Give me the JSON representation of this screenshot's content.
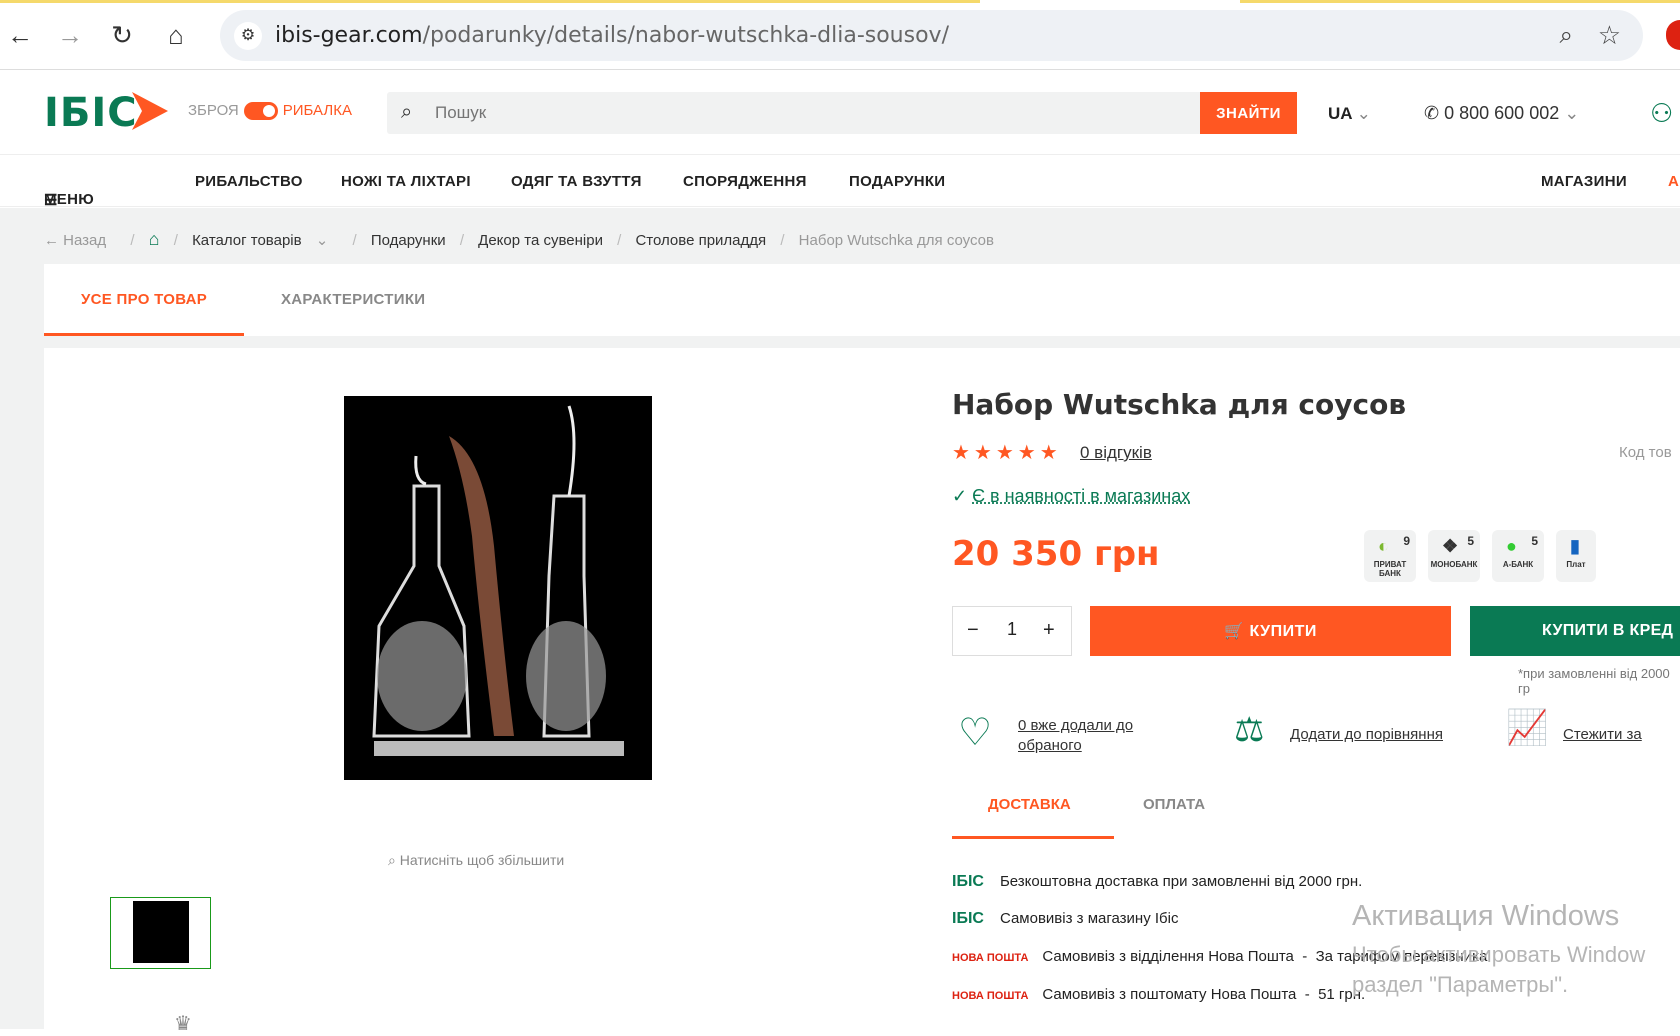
{
  "browser": {
    "url_domain": "ibis-gear.com",
    "url_path": "/podarunky/details/nabor-wutschka-dlia-sousov/"
  },
  "header": {
    "logo": "IБIС",
    "switch_left": "ЗБРОЯ",
    "switch_right": "РИБАЛКА",
    "search_placeholder": "Пошук",
    "search_button": "ЗНАЙТИ",
    "lang": "UA",
    "phone": "0 800 600 002"
  },
  "menu": {
    "toggle": "МЕНЮ",
    "items": [
      "РИБАЛЬСТВО",
      "НОЖІ ТА ЛІХТАРІ",
      "ОДЯГ ТА ВЗУТТЯ",
      "СПОРЯДЖЕННЯ",
      "ПОДАРУНКИ"
    ],
    "stores": "МАГАЗИНИ",
    "cut": "А"
  },
  "breadcrumbs": {
    "back": "Назад",
    "catalog": "Каталог товарів",
    "items": [
      "Подарунки",
      "Декор та сувеніри",
      "Столове приладдя"
    ],
    "current": "Набор Wutschka для соусов"
  },
  "tabs": {
    "about": "УСЕ ПРО ТОВАР",
    "specs": "ХАРАКТЕРИСТИКИ"
  },
  "gallery": {
    "zoom_hint": "Натисніть щоб збільшити"
  },
  "product": {
    "title": "Набор Wutschka для соусов",
    "stars": "★★★★★",
    "reviews": "0 відгуків",
    "code_label": "Код тов",
    "stock": "Є в наявності в магазинах",
    "price": "20 350 грн",
    "qty": "1",
    "buy": "КУПИТИ",
    "credit": "КУПИТИ В КРЕД",
    "credit_note": "*при замовленні від 2000 гр",
    "banks": [
      {
        "label": "ПРИВАТ БАНК",
        "n": "9"
      },
      {
        "label": "МОНОБАНК",
        "n": "5"
      },
      {
        "label": "А-БАНК",
        "n": "5"
      },
      {
        "label": "Плат",
        "n": ""
      }
    ]
  },
  "actions": {
    "favorite": "0 вже додали до обраного",
    "compare": "Додати до порівняння",
    "track": "Стежити за"
  },
  "delivery": {
    "tab_delivery": "ДОСТАВКА",
    "tab_payment": "ОПЛАТА",
    "rows": [
      {
        "brand": "IБIС",
        "text": "Безкоштовна доставка при замовленні від 2000 грн.",
        "price": ""
      },
      {
        "brand": "IБIС",
        "text": "Самовивіз з магазину Ібіс",
        "price": ""
      },
      {
        "brand": "НОВА ПОШТА",
        "text": "Самовивіз з відділення Нова Пошта",
        "price": "За тарифом перевізника"
      },
      {
        "brand": "НОВА ПОШТА",
        "text": "Самовивіз з поштомату Нова Пошта",
        "price": "51 грн."
      }
    ]
  },
  "watermark": {
    "line1": "Активация Windows",
    "line2": "Чтобы активировать Window",
    "line3": "раздел \"Параметры\"."
  }
}
